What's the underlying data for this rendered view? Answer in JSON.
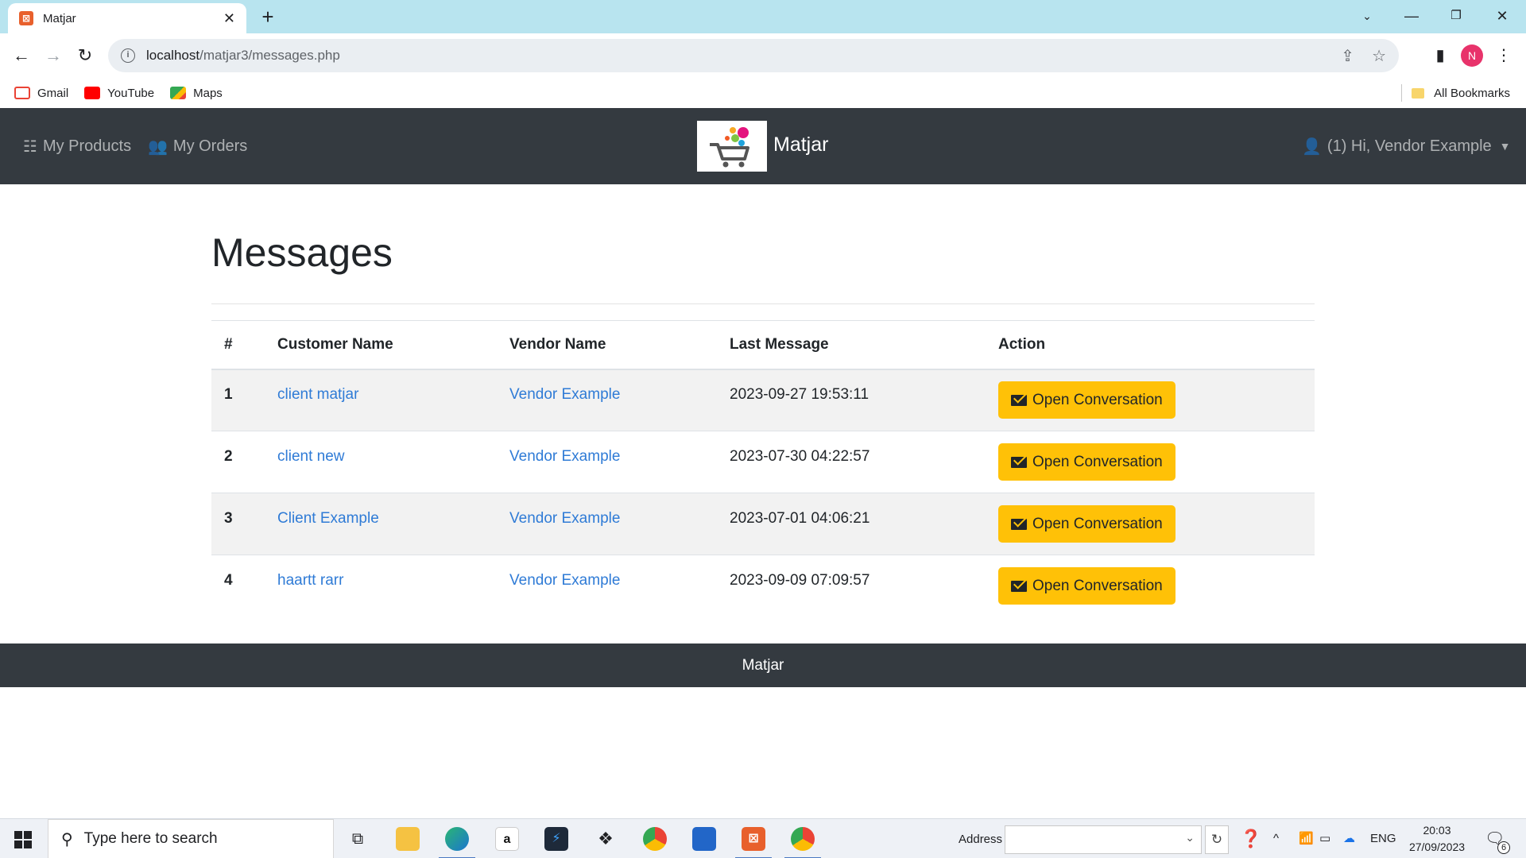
{
  "browser": {
    "tab_title": "Matjar",
    "new_tab": "+",
    "url_host": "localhost",
    "url_path": "/matjar3/messages.php",
    "profile_initial": "N",
    "bookmarks": [
      {
        "label": "Gmail",
        "icon": "gmail-icon",
        "color": "#ea4335"
      },
      {
        "label": "YouTube",
        "icon": "youtube-icon",
        "color": "#ff0000"
      },
      {
        "label": "Maps",
        "icon": "maps-icon",
        "color": "#34a853"
      }
    ],
    "all_bookmarks": "All Bookmarks"
  },
  "site": {
    "nav_products": "My Products",
    "nav_orders": "My Orders",
    "brand_name": "Matjar",
    "user_menu": "(1) Hi, Vendor Example",
    "colors": {
      "navbar": "#343a40",
      "link": "#2f7bd6",
      "action_button": "#ffc107"
    }
  },
  "page": {
    "title": "Messages",
    "table": {
      "headers": [
        "#",
        "Customer Name",
        "Vendor Name",
        "Last Message",
        "Action"
      ],
      "rows": [
        {
          "num": "1",
          "customer": "client matjar",
          "vendor": "Vendor Example",
          "last_message": "2023-09-27 19:53:11",
          "action": "Open Conversation"
        },
        {
          "num": "2",
          "customer": "client new",
          "vendor": "Vendor Example",
          "last_message": "2023-07-30 04:22:57",
          "action": "Open Conversation"
        },
        {
          "num": "3",
          "customer": "Client Example",
          "vendor": "Vendor Example",
          "last_message": "2023-07-01 04:06:21",
          "action": "Open Conversation"
        },
        {
          "num": "4",
          "customer": "haartt rarr",
          "vendor": "Vendor Example",
          "last_message": "2023-09-09 07:09:57",
          "action": "Open Conversation"
        }
      ]
    }
  },
  "footer": {
    "text": "Matjar"
  },
  "taskbar": {
    "search_placeholder": "Type here to search",
    "address_label": "Address",
    "language": "ENG",
    "time": "20:03",
    "date": "27/09/2023",
    "notification_count": "6"
  }
}
